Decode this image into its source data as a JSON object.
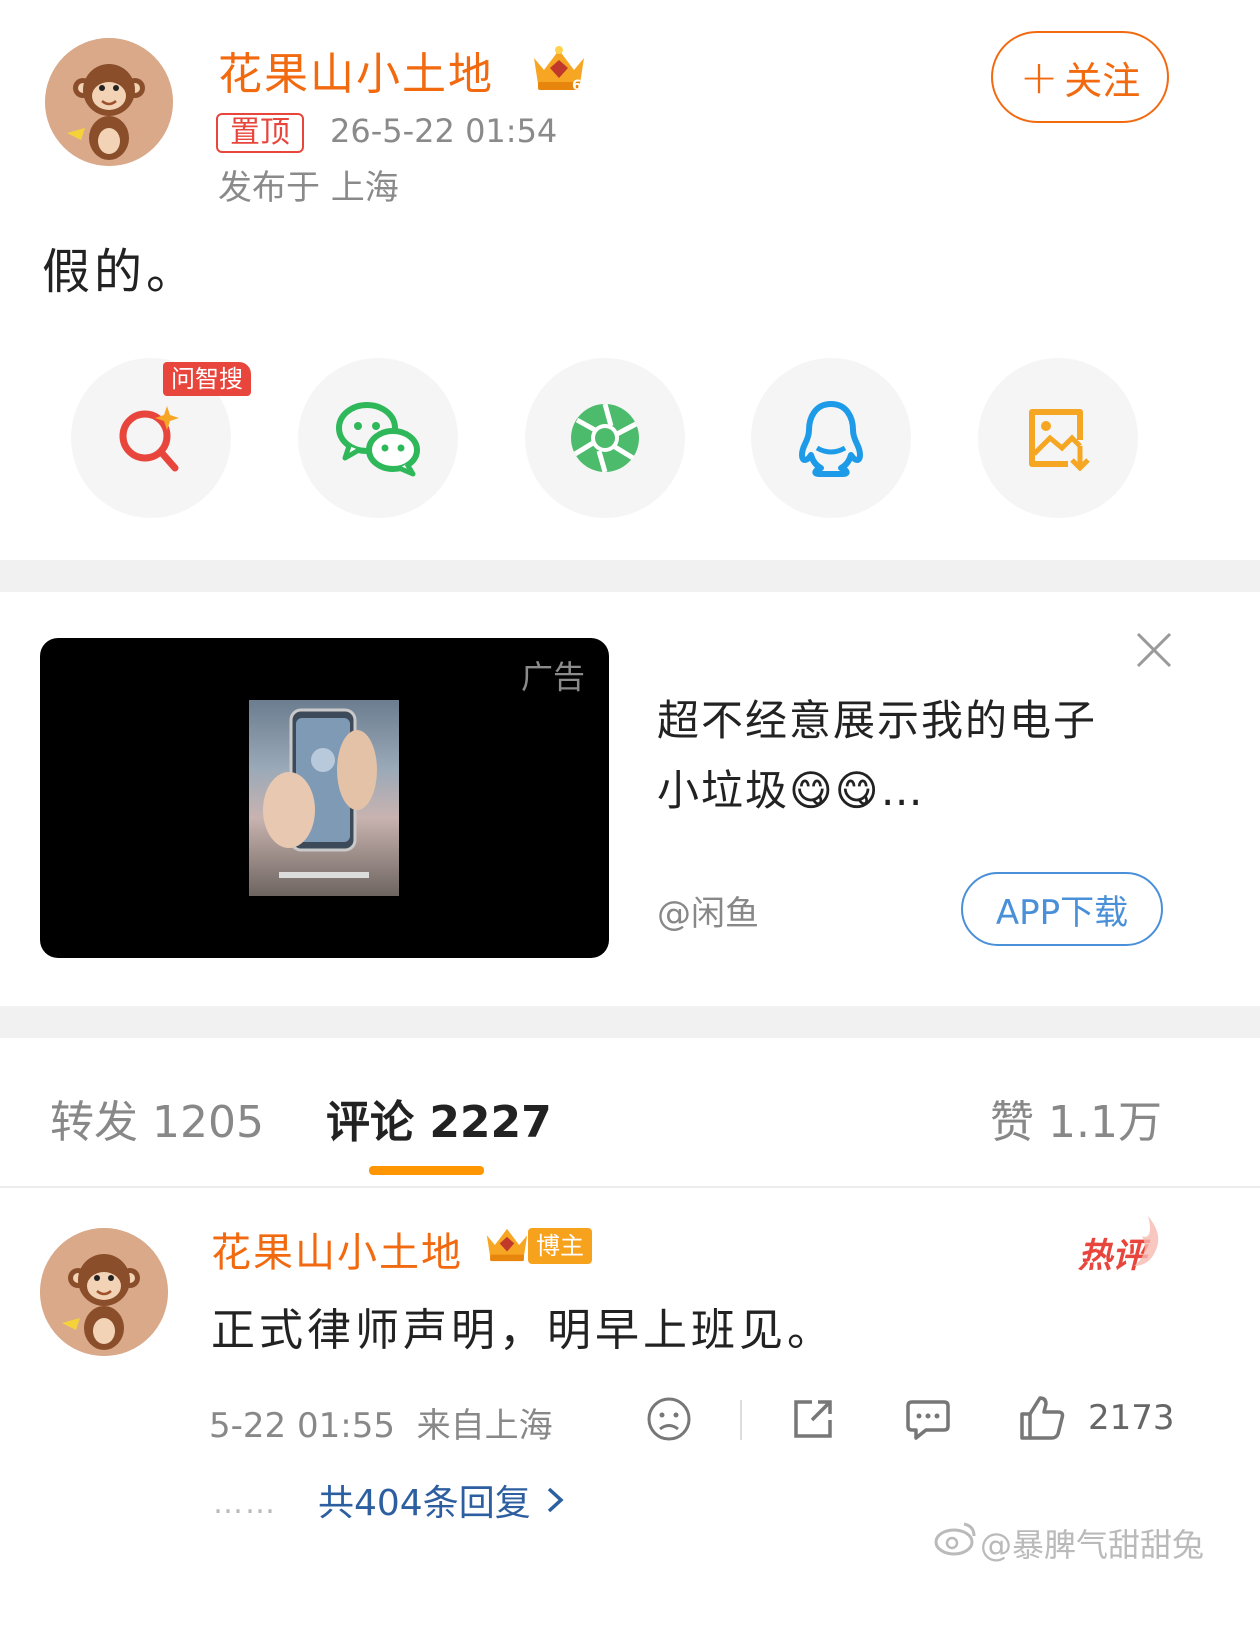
{
  "post": {
    "author": "花果山小土地",
    "pin_label": "置顶",
    "time": "26-5-22 01:54",
    "location": "发布于 上海",
    "follow_label": "关注",
    "follow_plus": "+",
    "text": "假的。"
  },
  "share": {
    "ai_tag": "问智搜",
    "items": [
      {
        "name": "ai-search",
        "icon": "search-sparkle-icon"
      },
      {
        "name": "wechat",
        "icon": "wechat-icon"
      },
      {
        "name": "moments",
        "icon": "moments-aperture-icon"
      },
      {
        "name": "qq",
        "icon": "qq-penguin-icon"
      },
      {
        "name": "save-image",
        "icon": "save-image-icon"
      }
    ]
  },
  "ad": {
    "label": "广告",
    "title_line1": "超不经意展示我的电子",
    "title_line2": "小垃圾😋😋…",
    "source": "@闲鱼",
    "button_label": "APP下载"
  },
  "tabs": {
    "repost": "转发 1205",
    "comments": "评论 2227",
    "likes": "赞 1.1万"
  },
  "comment": {
    "author": "花果山小土地",
    "badge": "博主",
    "hot_tag": "热评",
    "text": "正式律师声明，明早上班见。",
    "meta": "5-22 01:55  来自上海",
    "like_count": "2173",
    "replies_dots": "……",
    "replies_label": "共404条回复"
  },
  "watermark": "@暴脾气甜甜兔",
  "colors": {
    "accent_orange": "#f26a10",
    "red": "#e8463c",
    "link_blue": "#2d5fa0",
    "button_blue": "#4a90d9",
    "tab_underline": "#ff9500"
  }
}
